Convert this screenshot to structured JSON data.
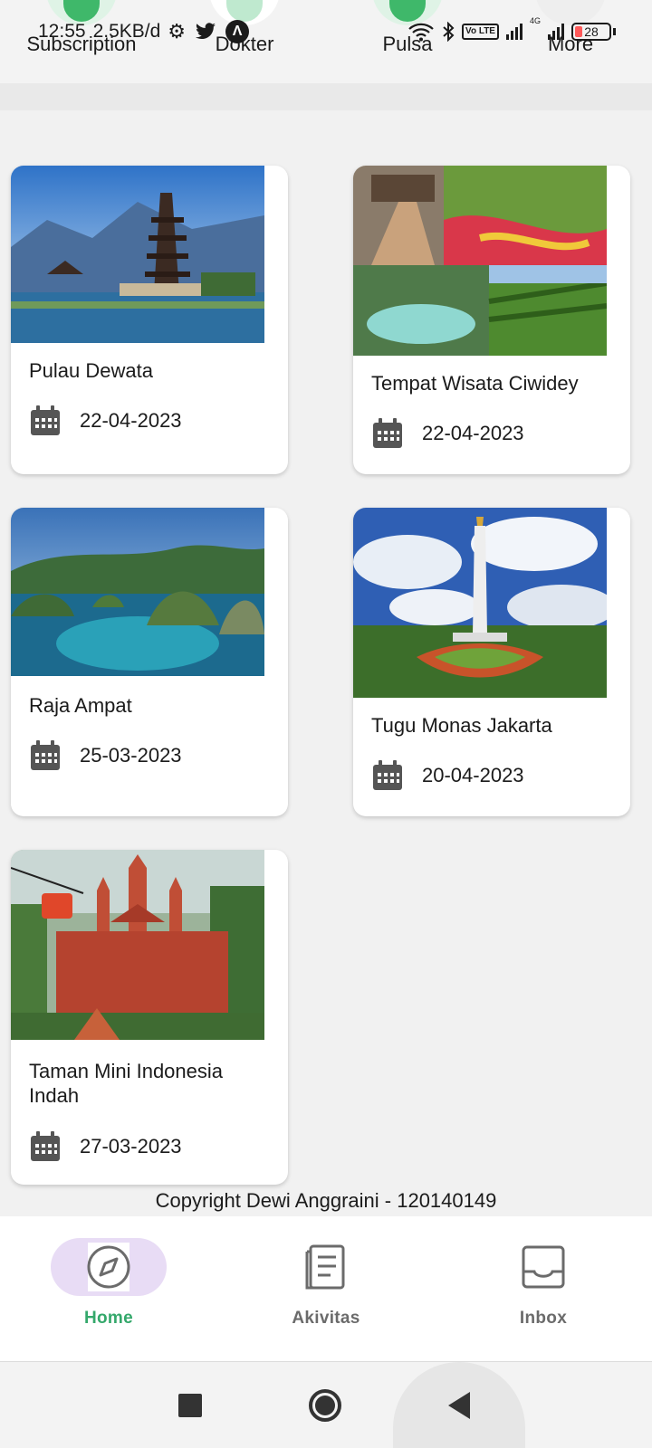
{
  "status_bar": {
    "time": "12:55",
    "net_speed": "2.5KB/d",
    "network": "4G",
    "volte": "Vo LTE",
    "battery": "28"
  },
  "shortcuts": [
    {
      "label": "Subscription",
      "icon": "subscription-icon"
    },
    {
      "label": "Dokter",
      "icon": "doctor-icon"
    },
    {
      "label": "Pulsa",
      "icon": "pulsa-icon"
    },
    {
      "label": "More",
      "icon": "more-icon"
    }
  ],
  "cards": [
    {
      "title": "Pulau Dewata",
      "date": "22-04-2023",
      "photo": "bali-temple-photo"
    },
    {
      "title": "Tempat Wisata Ciwidey",
      "date": "22-04-2023",
      "photo": "ciwidey-collage-photo"
    },
    {
      "title": "Raja Ampat",
      "date": "25-03-2023",
      "photo": "raja-ampat-photo"
    },
    {
      "title": "Tugu Monas Jakarta",
      "date": "20-04-2023",
      "photo": "monas-photo"
    },
    {
      "title": "Taman Mini Indonesia Indah",
      "date": "27-03-2023",
      "photo": "tmii-photo"
    }
  ],
  "copyright": "Copyright Dewi Anggraini - 120140149",
  "bottom_nav": [
    {
      "label": "Home",
      "icon": "compass-icon",
      "active": true
    },
    {
      "label": "Akivitas",
      "icon": "activity-list-icon",
      "active": false
    },
    {
      "label": "Inbox",
      "icon": "inbox-icon",
      "active": false
    }
  ],
  "colors": {
    "accent": "#34a86b",
    "active_pill": "#e8dcf5",
    "background": "#f1f1f1"
  }
}
